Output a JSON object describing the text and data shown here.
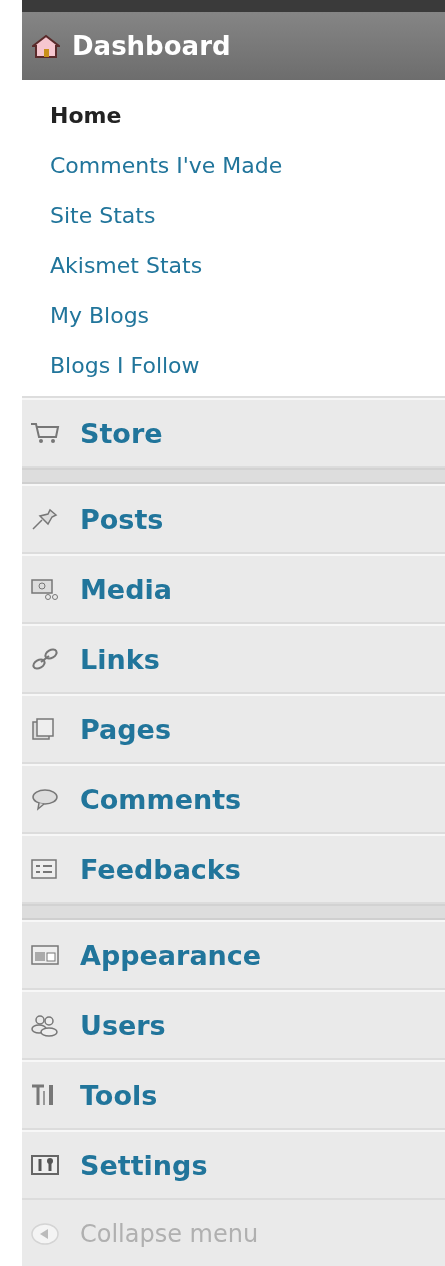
{
  "header": {
    "title": "Dashboard"
  },
  "submenu": [
    {
      "label": "Home",
      "selected": true
    },
    {
      "label": "Comments I've Made",
      "selected": false
    },
    {
      "label": "Site Stats",
      "selected": false
    },
    {
      "label": "Akismet Stats",
      "selected": false
    },
    {
      "label": "My Blogs",
      "selected": false
    },
    {
      "label": "Blogs I Follow",
      "selected": false
    }
  ],
  "menu_groups": [
    [
      {
        "label": "Store"
      }
    ],
    [
      {
        "label": "Posts"
      },
      {
        "label": "Media"
      },
      {
        "label": "Links"
      },
      {
        "label": "Pages"
      },
      {
        "label": "Comments"
      },
      {
        "label": "Feedbacks"
      }
    ],
    [
      {
        "label": "Appearance"
      },
      {
        "label": "Users"
      },
      {
        "label": "Tools"
      },
      {
        "label": "Settings"
      }
    ]
  ],
  "collapse": {
    "label": "Collapse menu"
  }
}
